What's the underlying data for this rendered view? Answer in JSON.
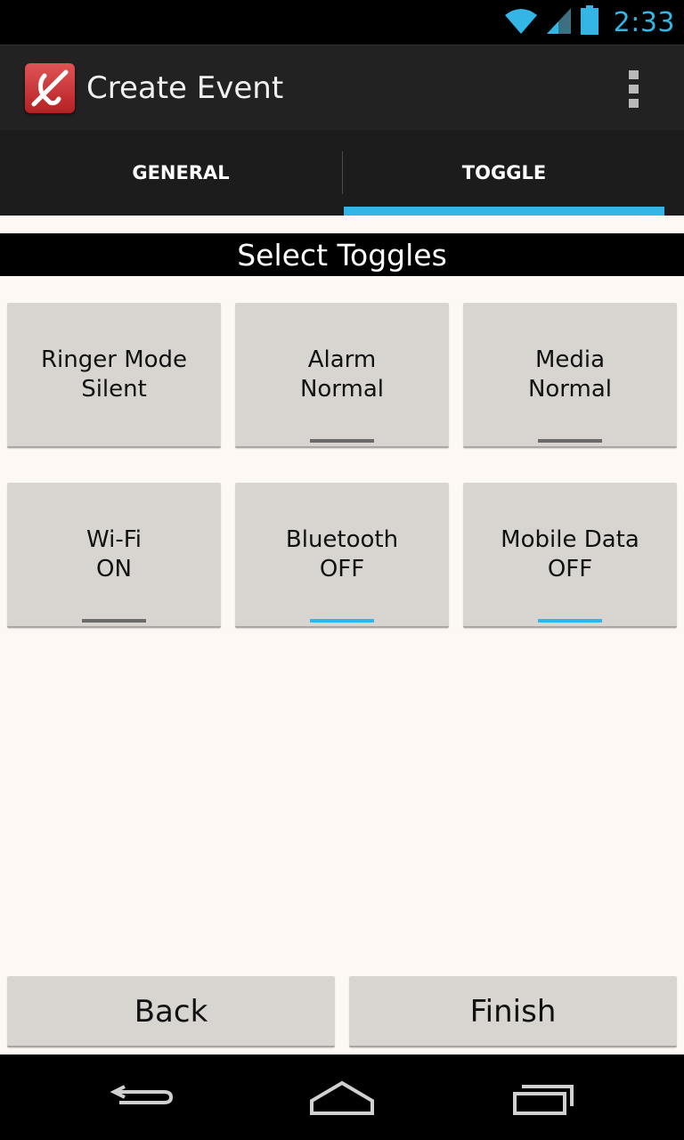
{
  "status_bar": {
    "time": "2:33",
    "icons": [
      "wifi-icon",
      "signal-icon",
      "battery-icon"
    ],
    "accent": "#33b5e5"
  },
  "action_bar": {
    "title": "Create Event",
    "icon": "app-logo-icon",
    "menu_icon": "overflow-menu-icon"
  },
  "tabs": [
    {
      "label": "GENERAL",
      "selected": false
    },
    {
      "label": "TOGGLE",
      "selected": true
    }
  ],
  "section": {
    "title": "Select Toggles"
  },
  "toggles": [
    {
      "name": "Ringer Mode",
      "state": "Silent",
      "indicator": "none"
    },
    {
      "name": "Alarm",
      "state": "Normal",
      "indicator": "off"
    },
    {
      "name": "Media",
      "state": "Normal",
      "indicator": "off"
    },
    {
      "name": "Wi-Fi",
      "state": "ON",
      "indicator": "off"
    },
    {
      "name": "Bluetooth",
      "state": "OFF",
      "indicator": "on"
    },
    {
      "name": "Mobile Data",
      "state": "OFF",
      "indicator": "on"
    }
  ],
  "buttons": {
    "back": "Back",
    "finish": "Finish"
  },
  "nav": {
    "back_icon": "nav-back-icon",
    "home_icon": "nav-home-icon",
    "recent_icon": "nav-recent-apps-icon"
  },
  "colors": {
    "accent": "#33b5e5",
    "indicator_off": "#6a6a6a",
    "button_bg": "#d8d5d1"
  }
}
